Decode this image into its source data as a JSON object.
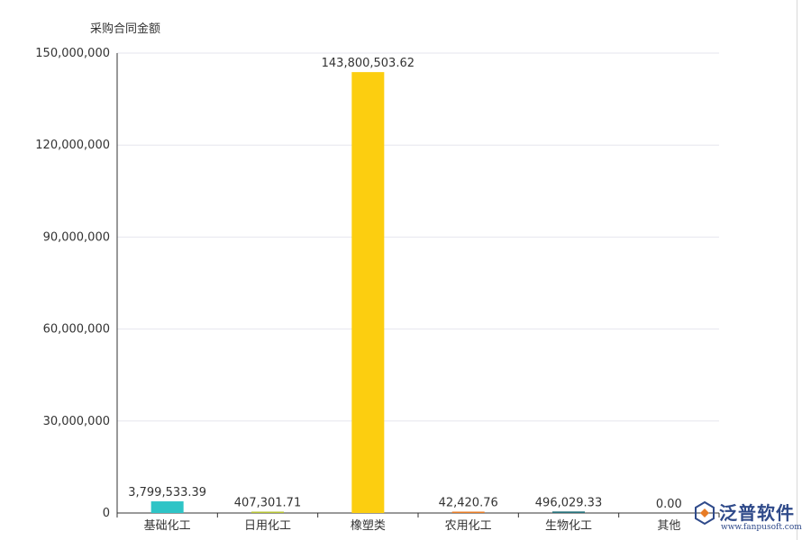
{
  "chart_data": {
    "type": "bar",
    "ylabel": "采购合同金额",
    "categories": [
      "基础化工",
      "日用化工",
      "橡塑类",
      "农用化工",
      "生物化工",
      "其他"
    ],
    "values": [
      3799533.39,
      407301.71,
      143800503.62,
      42420.76,
      496029.33,
      0.0
    ],
    "value_labels": [
      "3,799,533.39",
      "407,301.71",
      "143,800,503.62",
      "42,420.76",
      "496,029.33",
      "0.00"
    ],
    "ylim": [
      0,
      150000000
    ],
    "yticks": [
      0,
      30000000,
      60000000,
      90000000,
      120000000,
      150000000
    ],
    "ytick_labels": [
      "0",
      "30,000,000",
      "60,000,000",
      "90,000,000",
      "120,000,000",
      "150,000,000"
    ],
    "colors": [
      "#2ec4c6",
      "#b5c334",
      "#fcce10",
      "#e87c25",
      "#27727b",
      "#fe8463"
    ],
    "grid": true
  },
  "watermark": {
    "brand": "泛普软件",
    "url": "www.fanpusoft.com"
  }
}
